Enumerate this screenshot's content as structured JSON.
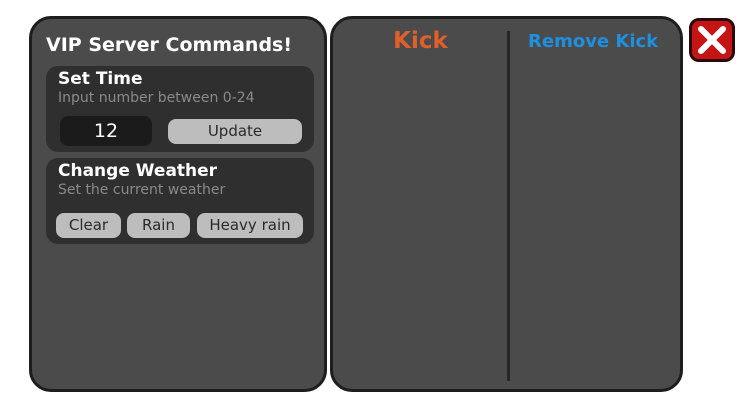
{
  "vip_panel": {
    "title": "VIP Server Commands!",
    "set_time": {
      "title": "Set Time",
      "subtitle": "Input number between 0-24",
      "input_value": "12",
      "update_label": "Update"
    },
    "change_weather": {
      "title": "Change Weather",
      "subtitle": "Set the current weather",
      "options": [
        "Clear",
        "Rain",
        "Heavy rain"
      ]
    }
  },
  "player_panel": {
    "kick_label": "Kick",
    "remove_kick_label": "Remove Kick"
  },
  "colors": {
    "panel_bg": "#4b4b4b",
    "card_bg": "#2f2f2f",
    "button_bg": "#bdbdbd",
    "kick_title": "#e0602b",
    "remove_kick_title": "#1e90e0",
    "close_button": "#c41414"
  },
  "icons": {
    "close": "close-x-icon"
  }
}
